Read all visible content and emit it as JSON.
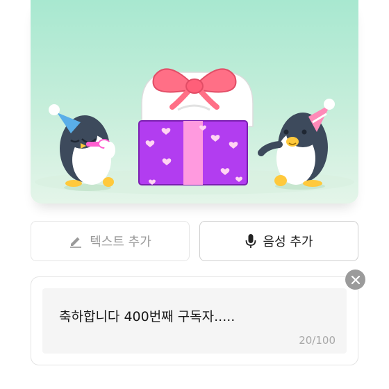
{
  "actions": {
    "add_text_label": "텍스트 추가",
    "add_voice_label": "음성 추가"
  },
  "message": {
    "text": "축하합니다 400번째 구독자.....",
    "char_count": "20/100"
  },
  "icons": {
    "add_text": "pencil-icon",
    "add_voice": "microphone-icon",
    "close": "close-icon"
  },
  "colors": {
    "illustration_bg_top": "#a8e8d0",
    "illustration_bg_bottom": "#dff3e6",
    "gift_box": "#b23df0",
    "ribbon": "#ff9adf",
    "bow": "#ff6f86",
    "close_button": "#9b9b9b"
  }
}
